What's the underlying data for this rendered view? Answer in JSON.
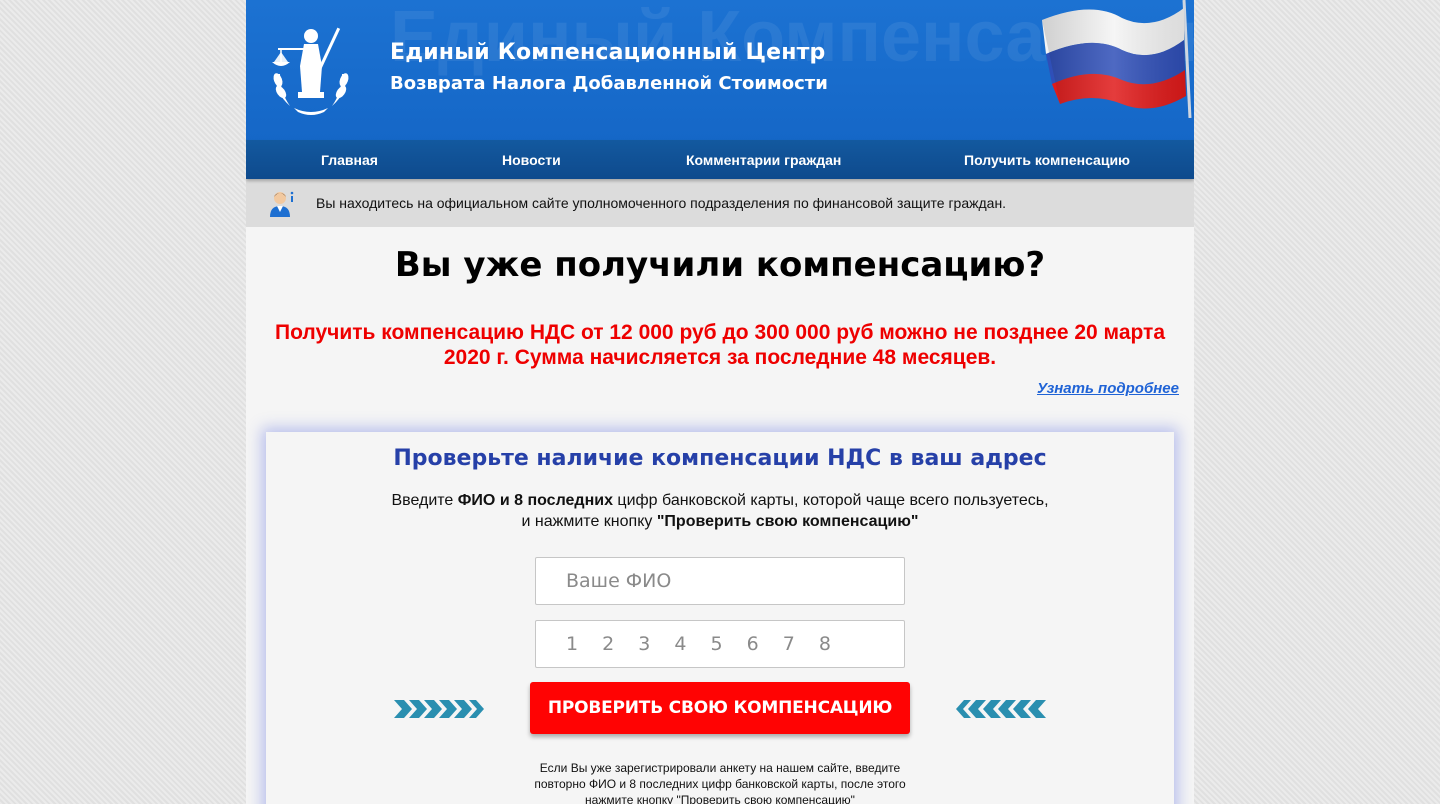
{
  "header": {
    "title": "Единый Компенсационный Центр",
    "subtitle": "Возврата Налога Добавленной Стоимости",
    "watermark": "Единый Компенсационный"
  },
  "nav": {
    "items": [
      {
        "label": "Главная"
      },
      {
        "label": "Новости"
      },
      {
        "label": "Комментарии граждан"
      },
      {
        "label": "Получить компенсацию"
      }
    ]
  },
  "info": {
    "text": "Вы находитесь на официальном сайте уполномоченного подразделения по финансовой защите граждан."
  },
  "hero": {
    "title": "Вы уже получили компенсацию?",
    "promo": "Получить компенсацию НДС от 12 000 руб до 300 000 руб можно не позднее 20 марта 2020 г. Сумма начисляется за последние 48 месяцев.",
    "more_link": "Узнать подробнее"
  },
  "form": {
    "title": "Проверьте наличие компенсации НДС в ваш адрес",
    "instr_1": "Введите ",
    "instr_bold_1": "ФИО и 8 последних",
    "instr_2": " цифр банковской карты, которой чаще всего пользуетесь,",
    "instr_3": "и нажмите кнопку ",
    "instr_bold_2": "\"Проверить свою компенсацию\"",
    "fio_placeholder": "Ваше ФИО",
    "fio_value": "",
    "card_placeholder": "1 2 3 4 5 6 7 8",
    "card_value": "",
    "submit_label": "ПРОВЕРИТЬ СВОЮ КОМПЕНСАЦИЮ",
    "note": "Если Вы уже зарегистрировали анкету на нашем сайте, введите повторно ФИО и 8 последних цифр банковской карты, после этого нажмите кнопку \"Проверить свою компенсацию\""
  },
  "colors": {
    "header_blue": "#1a6dcc",
    "nav_blue": "#1256a4",
    "accent_red": "#ff0303",
    "form_title_blue": "#2640a8",
    "link_blue": "#1f63d6",
    "arrow_teal": "#2a8fb0"
  },
  "icons": {
    "logo": "themis-justice-logo",
    "flag": "russian-flag",
    "info": "user-info-icon",
    "arrows_left": "double-chevron-right-icon",
    "arrows_right": "double-chevron-left-icon"
  }
}
